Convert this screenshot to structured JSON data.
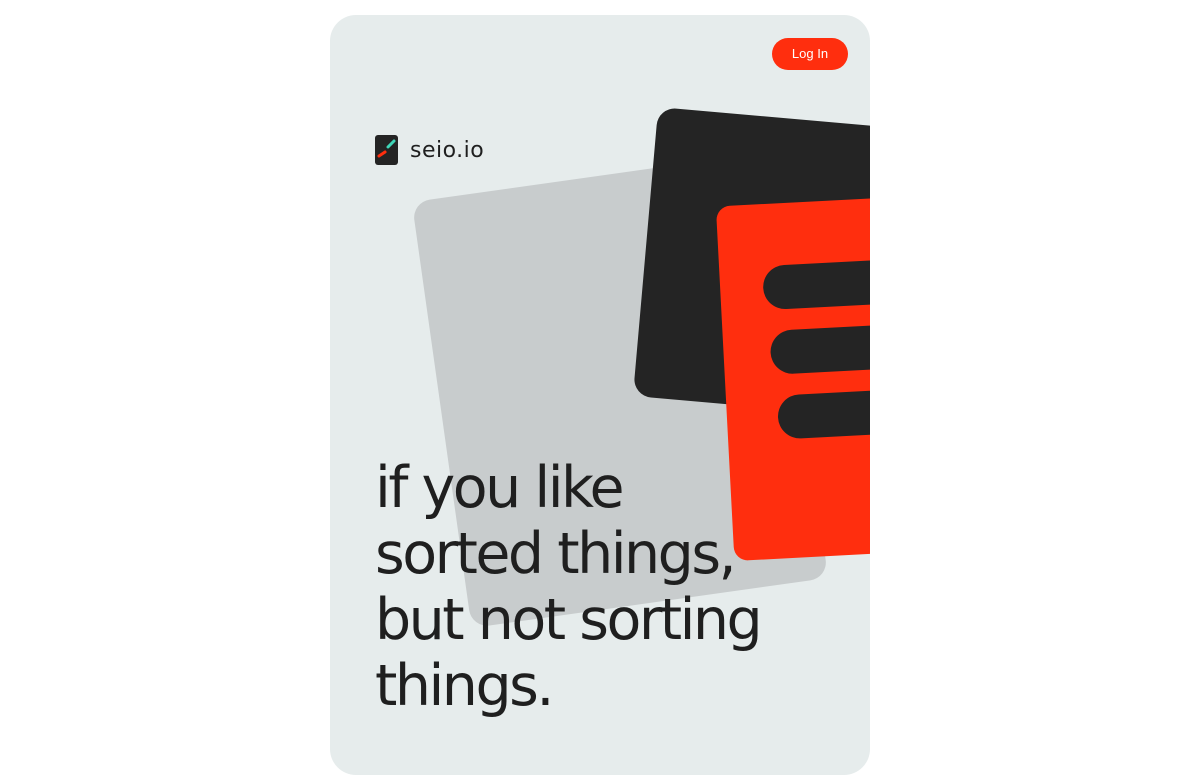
{
  "header": {
    "login_label": "Log In"
  },
  "brand": {
    "name": "seio.io",
    "logo_icon": "seio-logo-icon"
  },
  "hero": {
    "headline_lines": [
      "if you like",
      "sorted things,",
      "but not sorting",
      "things."
    ]
  },
  "colors": {
    "background": "#e6ecec",
    "accent": "#ff2e0e",
    "dark": "#242424",
    "gray_shape": "#c8cccd",
    "text": "#1f1f1f"
  }
}
